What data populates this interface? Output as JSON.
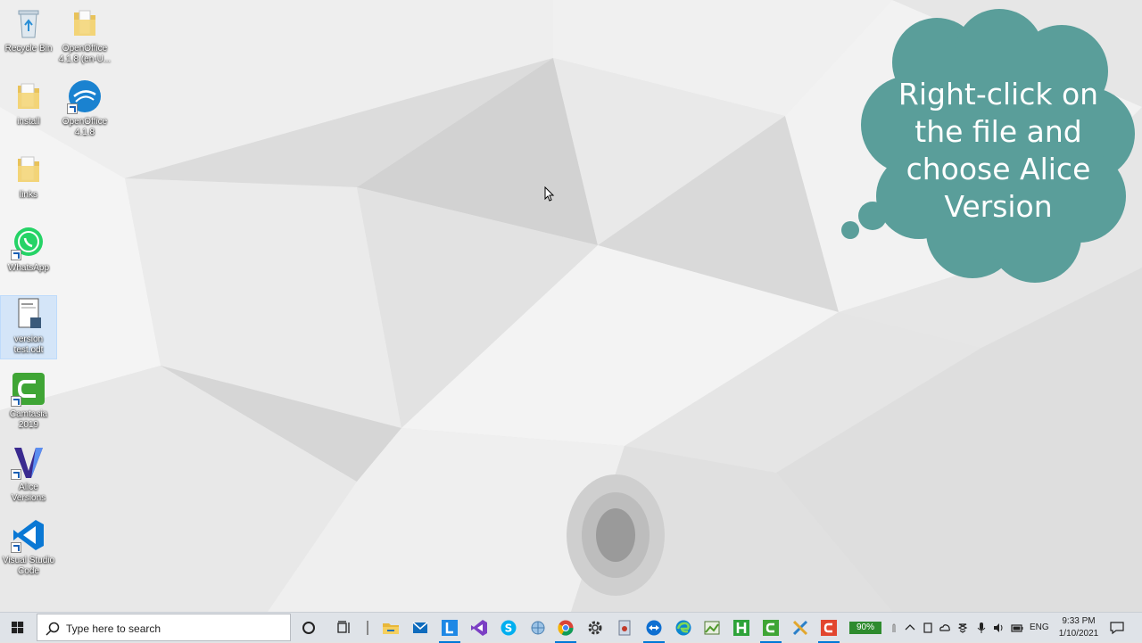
{
  "desktop": {
    "icons": [
      {
        "label": "Recycle Bin",
        "icon": "recycle-bin-icon"
      },
      {
        "label": "OpenOffice 4.1.8 (en-U...",
        "icon": "folder-icon"
      },
      {
        "label": "install",
        "icon": "folder-icon"
      },
      {
        "label": "OpenOffice 4.1.8",
        "icon": "openoffice-icon"
      },
      {
        "label": "links",
        "icon": "folder-icon"
      },
      {
        "label": "WhatsApp",
        "icon": "whatsapp-icon"
      },
      {
        "label": "version test.odt",
        "icon": "document-icon"
      },
      {
        "label": "Camtasia 2019",
        "icon": "camtasia-icon"
      },
      {
        "label": "Alice Versions",
        "icon": "alice-versions-icon"
      },
      {
        "label": "Visual Studio Code",
        "icon": "vscode-icon"
      }
    ]
  },
  "callout": {
    "text": "Right-click on the file and choose Alice Version",
    "color": "#5a9e9a"
  },
  "taskbar": {
    "search_placeholder": "Type here to search",
    "battery": "90%",
    "language": "ENG",
    "time": "9:33 PM",
    "date": "1/10/2021",
    "accent": "#0078d7"
  }
}
